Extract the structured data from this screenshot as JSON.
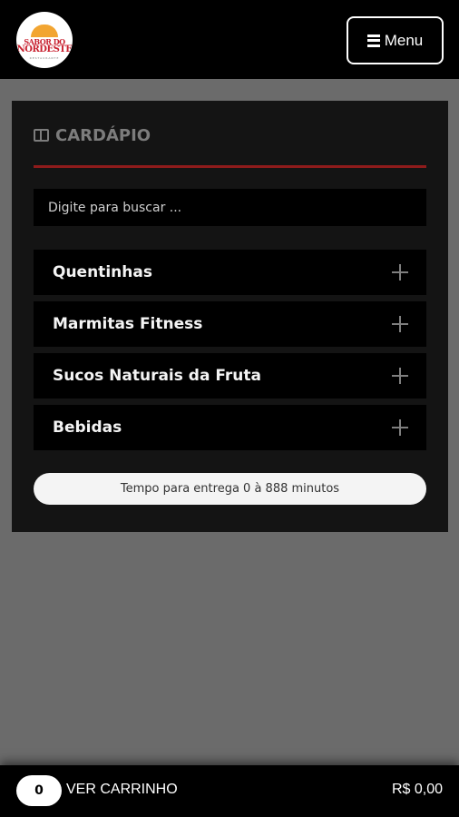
{
  "header": {
    "logo": {
      "line1": "SABOR DO",
      "line2": "NORDESTE",
      "line3": "RESTAURANTE"
    },
    "menu_label": "Menu"
  },
  "menu_panel": {
    "title": "CARDÁPIO",
    "search_placeholder": "Digite para buscar ...",
    "categories": [
      {
        "label": "Quentinhas"
      },
      {
        "label": "Marmitas Fitness"
      },
      {
        "label": "Sucos Naturais da Fruta"
      },
      {
        "label": "Bebidas"
      }
    ],
    "delivery_time": "Tempo para entrega 0 à 888 minutos"
  },
  "footer": {
    "cart_count": "0",
    "cart_label": "VER CARRINHO",
    "cart_total": "R$ 0,00"
  },
  "colors": {
    "header_bg": "#000000",
    "page_bg": "#6b6b6b",
    "panel_bg": "#141414",
    "accent_divider": "#8f1b1b",
    "logo_red": "#c8202f",
    "logo_orange": "#f2a531"
  }
}
